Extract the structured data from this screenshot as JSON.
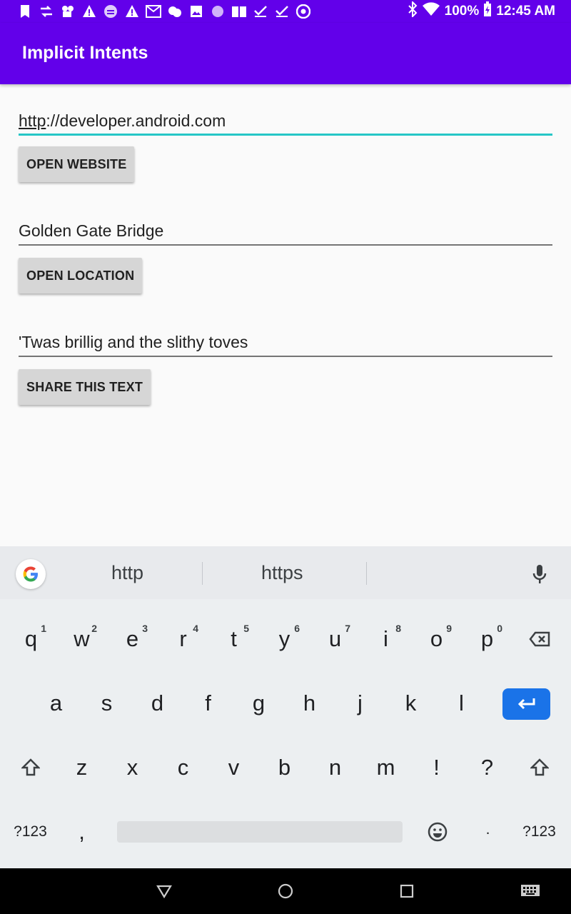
{
  "status_bar": {
    "battery": "100%",
    "time": "12:45 AM",
    "left_icons": [
      "bookmark-icon",
      "transfer-icon",
      "camera-icon",
      "warning-icon",
      "storage-icon",
      "warning-icon",
      "gmail-icon",
      "weather-icon",
      "photo-icon",
      "circle-icon",
      "book-icon",
      "check-icon",
      "check-icon",
      "chrome-icon"
    ],
    "right_icons": [
      "bluetooth-icon",
      "wifi-icon",
      "battery-icon"
    ]
  },
  "app_bar": {
    "title": "Implicit Intents",
    "color": "#6200ea"
  },
  "main": {
    "website": {
      "value_prefix": "http",
      "value_rest": "://developer.android.com",
      "button": "OPEN WEBSITE"
    },
    "location": {
      "value": "Golden Gate Bridge",
      "button": "OPEN LOCATION"
    },
    "share": {
      "value": "'Twas brillig and the slithy toves",
      "button": "SHARE THIS TEXT"
    }
  },
  "keyboard": {
    "suggestions": [
      "http",
      "https"
    ],
    "row1": [
      {
        "key": "q",
        "hint": "1"
      },
      {
        "key": "w",
        "hint": "2"
      },
      {
        "key": "e",
        "hint": "3"
      },
      {
        "key": "r",
        "hint": "4"
      },
      {
        "key": "t",
        "hint": "5"
      },
      {
        "key": "y",
        "hint": "6"
      },
      {
        "key": "u",
        "hint": "7"
      },
      {
        "key": "i",
        "hint": "8"
      },
      {
        "key": "o",
        "hint": "9"
      },
      {
        "key": "p",
        "hint": "0"
      }
    ],
    "row2": [
      "a",
      "s",
      "d",
      "f",
      "g",
      "h",
      "j",
      "k",
      "l"
    ],
    "row3": [
      "z",
      "x",
      "c",
      "v",
      "b",
      "n",
      "m",
      "!",
      "?"
    ],
    "row4": {
      "symbols_left": "?123",
      "comma": ",",
      "period": ".",
      "symbols_right": "?123"
    },
    "enter_color": "#1a73e8"
  }
}
